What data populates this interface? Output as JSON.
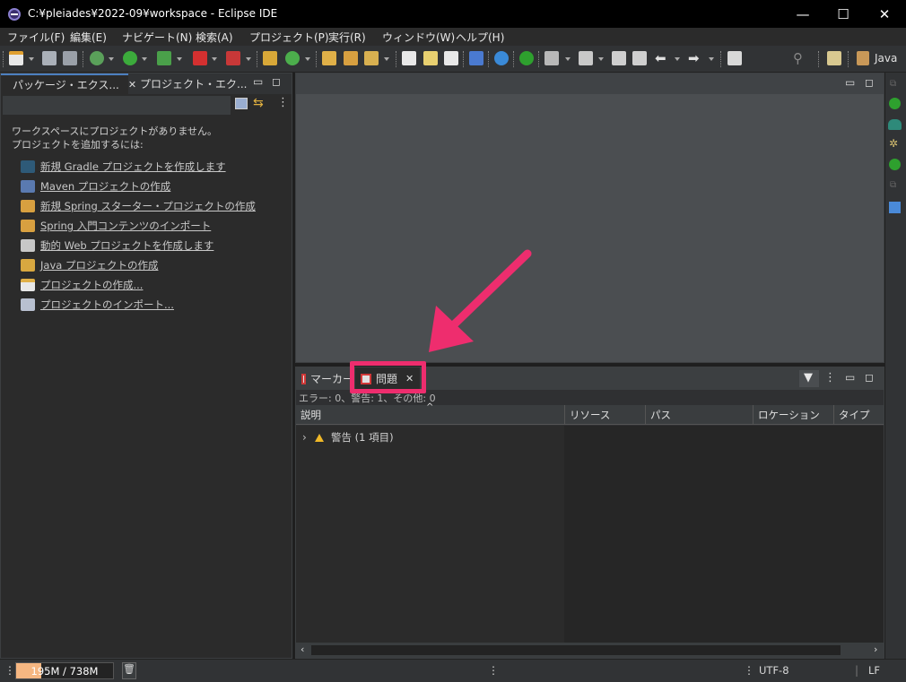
{
  "window": {
    "title": "C:¥pleiades¥2022-09¥workspace - Eclipse IDE",
    "minimize": "—",
    "maximize": "☐",
    "close": "✕"
  },
  "menu": [
    "ファイル(F)",
    "編集(E)",
    "ナビゲート(N)",
    "検索(A)",
    "プロジェクト(P)",
    "実行(R)",
    "ウィンドウ(W)",
    "ヘルプ(H)"
  ],
  "toolbar": {
    "perspective_label": "Java"
  },
  "left_panel": {
    "tabs": [
      {
        "label": "パッケージ・エクス...",
        "close": "✕"
      },
      {
        "label": "プロジェクト・エク..."
      }
    ],
    "hint_line1": "ワークスペースにプロジェクトがありません。",
    "hint_line2": "プロジェクトを追加するには:",
    "links": [
      {
        "label": "新規 Gradle プロジェクトを作成します",
        "icon": "gradle-icon"
      },
      {
        "label": "Maven プロジェクトの作成",
        "icon": "maven-icon"
      },
      {
        "label": "新規 Spring スターター・プロジェクトの作成",
        "icon": "spring-starter-icon"
      },
      {
        "label": "Spring 入門コンテンツのインポート",
        "icon": "spring-import-icon"
      },
      {
        "label": "動的 Web プロジェクトを作成します",
        "icon": "web-project-icon"
      },
      {
        "label": "Java プロジェクトの作成",
        "icon": "java-project-icon"
      },
      {
        "label": "プロジェクトの作成...",
        "icon": "new-project-icon"
      },
      {
        "label": "プロジェクトのインポート...",
        "icon": "import-icon"
      }
    ]
  },
  "problems_view": {
    "tabs": [
      {
        "label": "マーカー"
      },
      {
        "label": "問題",
        "close": "✕"
      }
    ],
    "summary": "エラー: 0、警告: 1、その他: 0",
    "columns": [
      "説明",
      "リソース",
      "パス",
      "ロケーション",
      "タイプ"
    ],
    "rows": [
      {
        "expander": "›",
        "label": "警告 (1 項目)"
      }
    ]
  },
  "status": {
    "heap": "195M / 738M",
    "heap_used_fraction": 0.26,
    "encoding": "UTF-8",
    "line_ending": "LF"
  },
  "colors": {
    "highlight": "#ee2d6e",
    "arrow": "#ee2d6e",
    "heap_fill": "#f6b782",
    "active_tab_accent": "#4c7fbf"
  }
}
